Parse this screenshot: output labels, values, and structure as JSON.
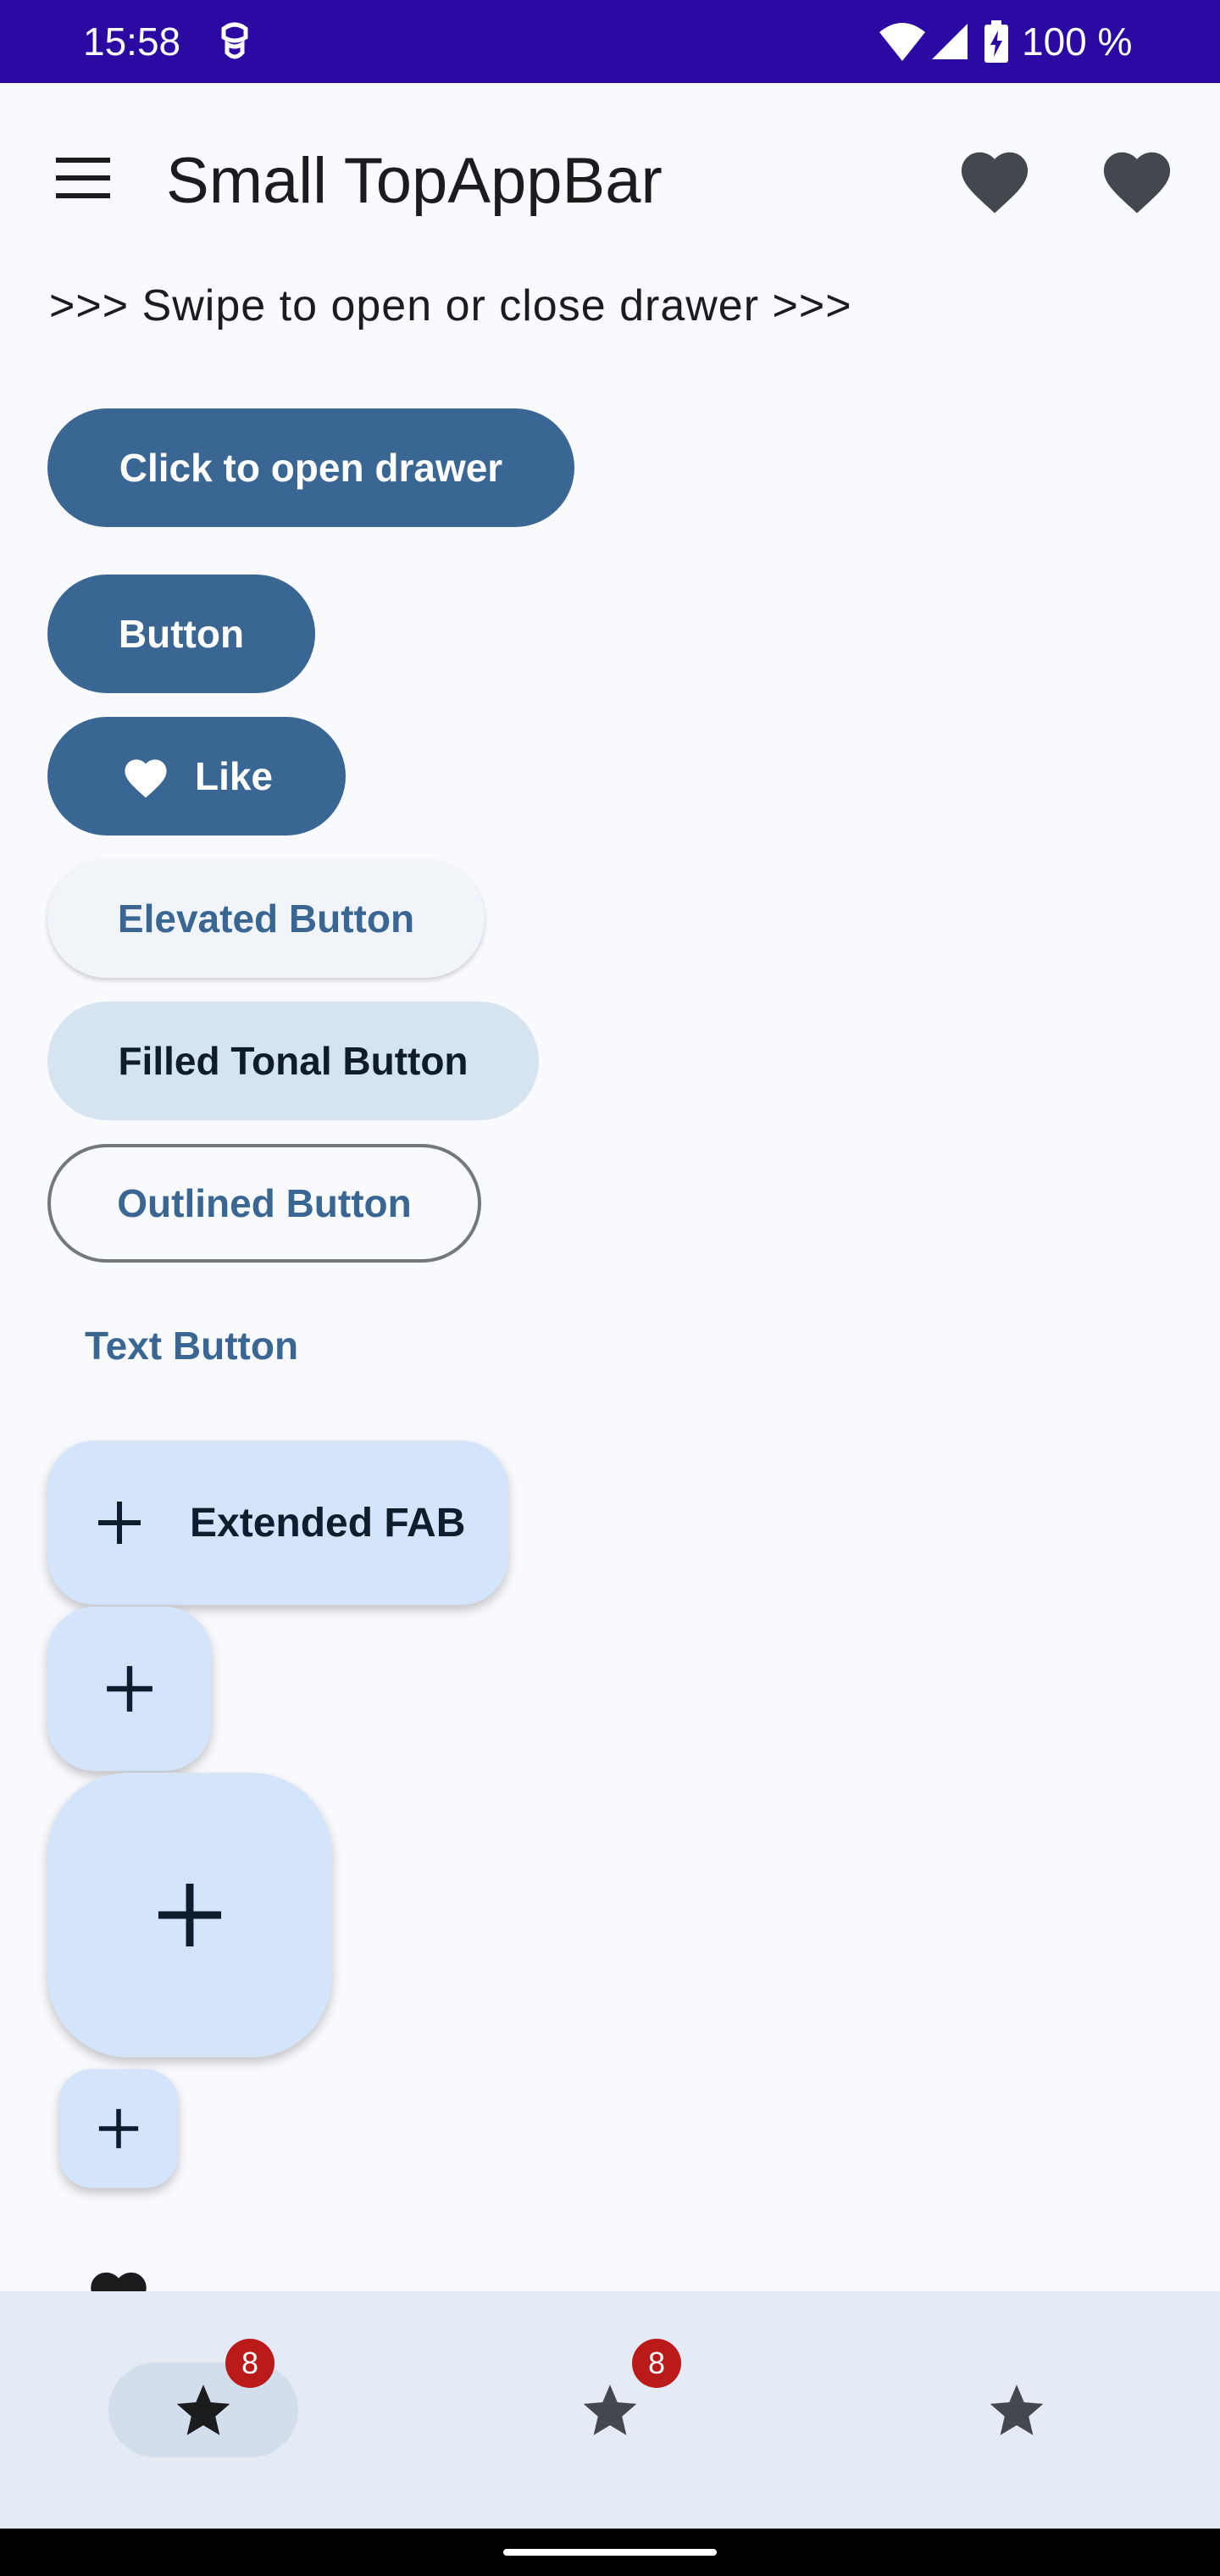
{
  "status_bar": {
    "time": "15:58",
    "battery": "100 %",
    "icons": [
      "notification-icon",
      "wifi-icon",
      "signal-icon",
      "battery-icon"
    ],
    "background": "#2b0aa3"
  },
  "top_app_bar": {
    "title": "Small TopAppBar",
    "navigation_icon": "menu-icon",
    "actions": [
      "favorite-icon",
      "favorite-icon"
    ]
  },
  "swipe_hint": ">>> Swipe to open or close drawer >>>",
  "buttons": {
    "open_drawer": "Click to open drawer",
    "button": "Button",
    "like": "Like",
    "elevated": "Elevated Button",
    "filled_tonal": "Filled Tonal Button",
    "outlined": "Outlined Button",
    "text": "Text Button"
  },
  "fabs": {
    "extended_label": "Extended FAB",
    "icon": "add-icon"
  },
  "bottom_nav": {
    "items": [
      {
        "icon": "star-icon",
        "badge": "8",
        "selected": true
      },
      {
        "icon": "star-icon",
        "badge": "8",
        "selected": false
      },
      {
        "icon": "star-icon",
        "badge": "",
        "selected": false
      }
    ]
  },
  "colors": {
    "primary": "#3a6694",
    "background": "#f9fafe",
    "fab_container": "#d3e4fb",
    "badge": "#ba1a1a",
    "nav_bar": "#e4ebf4"
  }
}
